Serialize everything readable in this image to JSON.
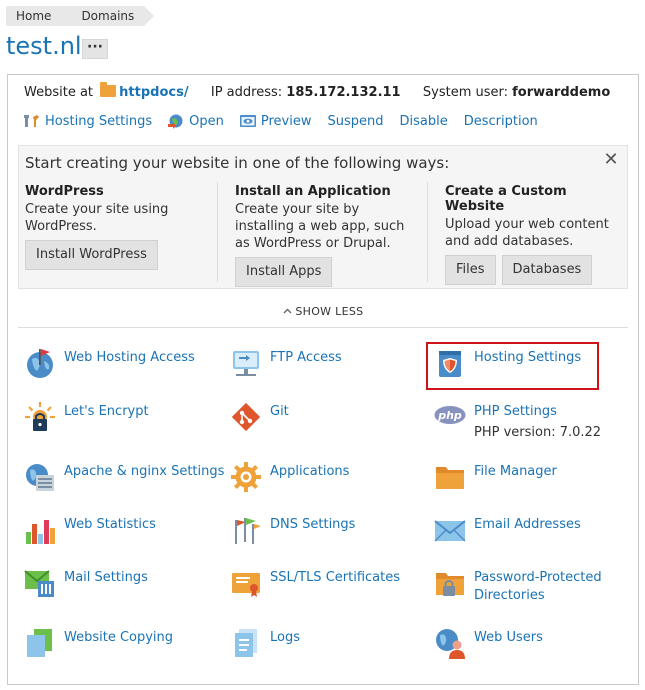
{
  "breadcrumb": {
    "home": "Home",
    "domains": "Domains"
  },
  "page": {
    "title": "test.nl",
    "more": "···"
  },
  "info": {
    "website_at_label": "Website at",
    "website_folder": "httpdocs/",
    "ip_label": "IP address:",
    "ip_value": "185.172.132.11",
    "user_label": "System user:",
    "user_value": "forwarddemo"
  },
  "actions": {
    "hosting_settings": "Hosting Settings",
    "open": "Open",
    "preview": "Preview",
    "suspend": "Suspend",
    "disable": "Disable",
    "description": "Description"
  },
  "start": {
    "title": "Start creating your website in one of the following ways:",
    "close": "✕",
    "wordpress": {
      "title": "WordPress",
      "desc": "Create your site using WordPress.",
      "button": "Install WordPress"
    },
    "app": {
      "title": "Install an Application",
      "desc": "Create your site by installing a web app, such as WordPress or Drupal.",
      "button": "Install Apps"
    },
    "custom": {
      "title": "Create a Custom Website",
      "desc": "Upload your web content and add databases.",
      "files_button": "Files",
      "databases_button": "Databases"
    }
  },
  "show_less": "SHOW LESS",
  "tools": {
    "web_hosting_access": "Web Hosting Access",
    "ftp_access": "FTP Access",
    "hosting_settings": "Hosting Settings",
    "lets_encrypt": "Let's Encrypt",
    "git": "Git",
    "php_settings": "PHP Settings",
    "php_version": "PHP version: 7.0.22",
    "apache_nginx": "Apache & nginx Settings",
    "applications": "Applications",
    "file_manager": "File Manager",
    "web_statistics": "Web Statistics",
    "dns_settings": "DNS Settings",
    "email_addresses": "Email Addresses",
    "mail_settings": "Mail Settings",
    "ssl_tls": "SSL/TLS Certificates",
    "password_protected": "Password-Protected Directories",
    "website_copying": "Website Copying",
    "logs": "Logs",
    "web_users": "Web Users"
  },
  "php_badge": "php",
  "colors": {
    "link": "#1a73b5",
    "highlight": "#d0131a",
    "folder": "#f0a23a"
  }
}
